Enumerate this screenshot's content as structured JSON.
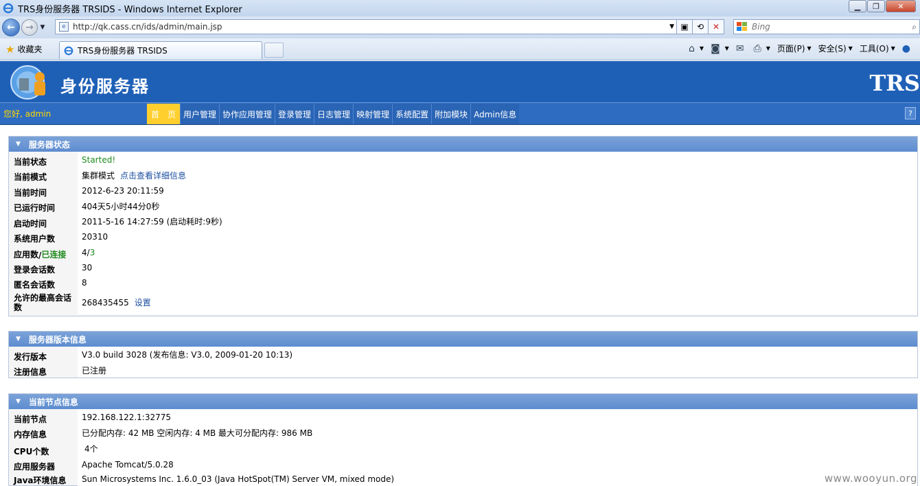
{
  "window": {
    "title": "TRS身份服务器 TRSIDS - Windows Internet Explorer"
  },
  "address_bar": {
    "url": "http://qk.cass.cn/ids/admin/main.jsp",
    "search_placeholder": "Bing"
  },
  "favorites": {
    "label": "收藏夹"
  },
  "tab": {
    "title": "TRS身份服务器 TRSIDS"
  },
  "command_bar": {
    "page": "页面(P)",
    "safety": "安全(S)",
    "tools": "工具(O)"
  },
  "header": {
    "brand": "身份服务器",
    "trs": "TRS",
    "greeting": "您好, admin"
  },
  "menu": [
    "首　页",
    "用户管理",
    "协作应用管理",
    "登录管理",
    "日志管理",
    "映射管理",
    "系统配置",
    "附加模块",
    "Admin信息"
  ],
  "help_label": "?",
  "server_status": {
    "title": "服务器状态",
    "current_status_label": "当前状态",
    "current_status": "Started!",
    "mode_label": "当前模式",
    "mode": "集群模式",
    "mode_link": "点击查看详细信息",
    "time_label": "当前时间",
    "time": "2012-6-23 20:11:59",
    "uptime_label": "已运行时间",
    "uptime": "404天5小时44分0秒",
    "start_label": "启动时间",
    "start": "2011-5-16 14:27:59 (启动耗时:9秒)",
    "users_label": "系统用户数",
    "users": "20310",
    "apps_label_a": "应用数",
    "apps_sep": " / ",
    "apps_label_b": "已连接",
    "apps_total": "4",
    "apps_slash": " / ",
    "apps_connected": "3",
    "login_sessions_label": "登录会话数",
    "login_sessions": "30",
    "anon_sessions_label": "匿名会话数",
    "anon_sessions": "8",
    "max_sessions_label": "允许的最高会话数",
    "max_sessions": "268435455",
    "max_sessions_link": "设置"
  },
  "version_info": {
    "title": "服务器版本信息",
    "release_label": "发行版本",
    "release": "V3.0 build 3028  (发布信息: V3.0, 2009-01-20 10:13)",
    "reg_label": "注册信息",
    "reg": "已注册"
  },
  "node_info": {
    "title": "当前节点信息",
    "node_label": "当前节点",
    "node": "192.168.122.1:32775",
    "mem_label": "内存信息",
    "mem": "已分配内存: 42 MB  空闲内存: 4 MB  最大可分配内存: 986 MB",
    "cpu_label": "CPU个数",
    "cpu": "4个",
    "appserver_label": "应用服务器",
    "appserver": "Apache Tomcat/5.0.28",
    "java_label": "Java环境信息",
    "java": "Sun Microsystems Inc. 1.6.0_03  (Java HotSpot(TM) Server VM, mixed mode)"
  },
  "watermark": "www.wooyun.org"
}
